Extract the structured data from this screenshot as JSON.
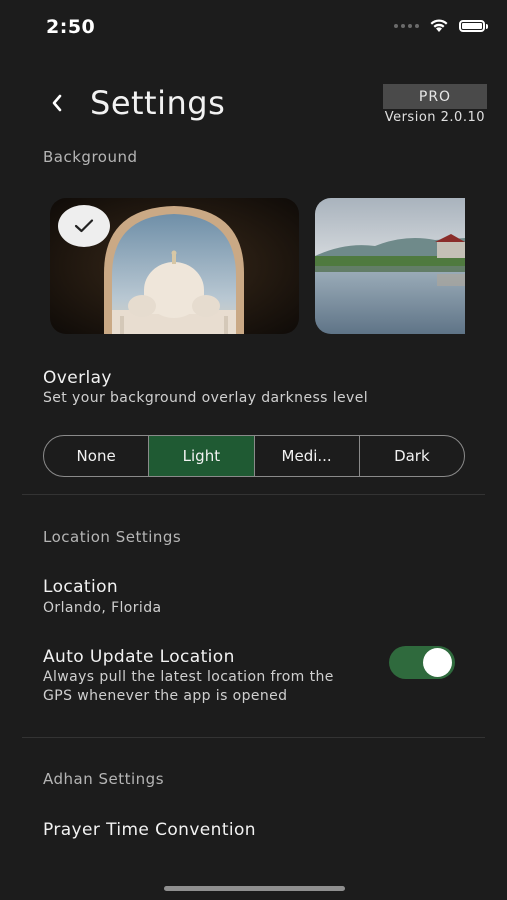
{
  "status_bar": {
    "time": "2:50"
  },
  "header": {
    "title": "Settings",
    "pro_badge": "PRO",
    "version": "Version 2.0.10"
  },
  "background": {
    "label": "Background",
    "thumbnails": [
      {
        "name": "mosque-arch",
        "selected": true
      },
      {
        "name": "lake-reflection",
        "selected": false
      }
    ]
  },
  "overlay": {
    "title": "Overlay",
    "subtitle": "Set your background overlay darkness level",
    "options": [
      "None",
      "Light",
      "Medi...",
      "Dark"
    ],
    "selected": "Light"
  },
  "location_settings": {
    "label": "Location Settings",
    "location": {
      "title": "Location",
      "value": "Orlando, Florida"
    },
    "auto_update": {
      "title": "Auto Update Location",
      "subtitle_line1": "Always pull the latest location from the",
      "subtitle_line2": "GPS whenever the app is opened",
      "enabled": true
    }
  },
  "adhan_settings": {
    "label": "Adhan Settings",
    "prayer_time_convention": {
      "title": "Prayer Time Convention"
    }
  },
  "colors": {
    "accent": "#1f5a33",
    "toggle_on": "#2f6a3d",
    "background": "#1c1c1c"
  }
}
